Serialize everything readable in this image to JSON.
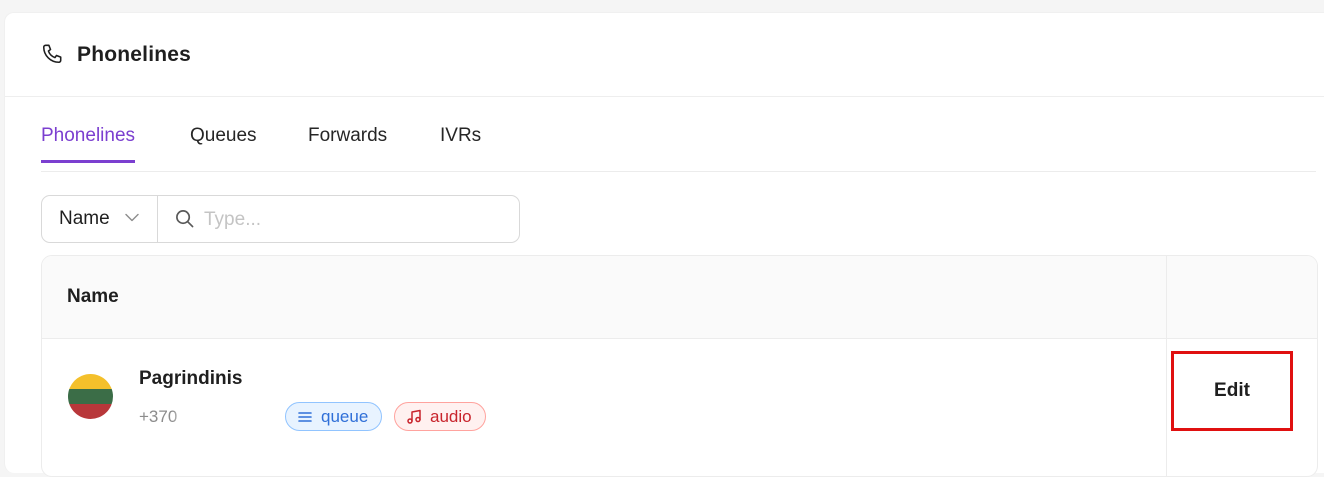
{
  "header": {
    "title": "Phonelines",
    "icon": "phone-icon"
  },
  "tabs": [
    {
      "label": "Phonelines",
      "active": true
    },
    {
      "label": "Queues",
      "active": false
    },
    {
      "label": "Forwards",
      "active": false
    },
    {
      "label": "IVRs",
      "active": false
    }
  ],
  "filter": {
    "field": "Name",
    "search_placeholder": "Type...",
    "search_value": ""
  },
  "table": {
    "columns": [
      "Name",
      ""
    ],
    "rows": [
      {
        "name": "Pagrindinis",
        "number": "+370",
        "flag_colors": [
          "#f4c02b",
          "#3b6d47",
          "#b8373a"
        ],
        "tags": [
          {
            "label": "queue",
            "icon": "list-icon"
          },
          {
            "label": "audio",
            "icon": "music-note-icon"
          }
        ],
        "action": "Edit"
      }
    ]
  },
  "colors": {
    "accent": "#7b3fd0",
    "highlight": "#e01010"
  }
}
